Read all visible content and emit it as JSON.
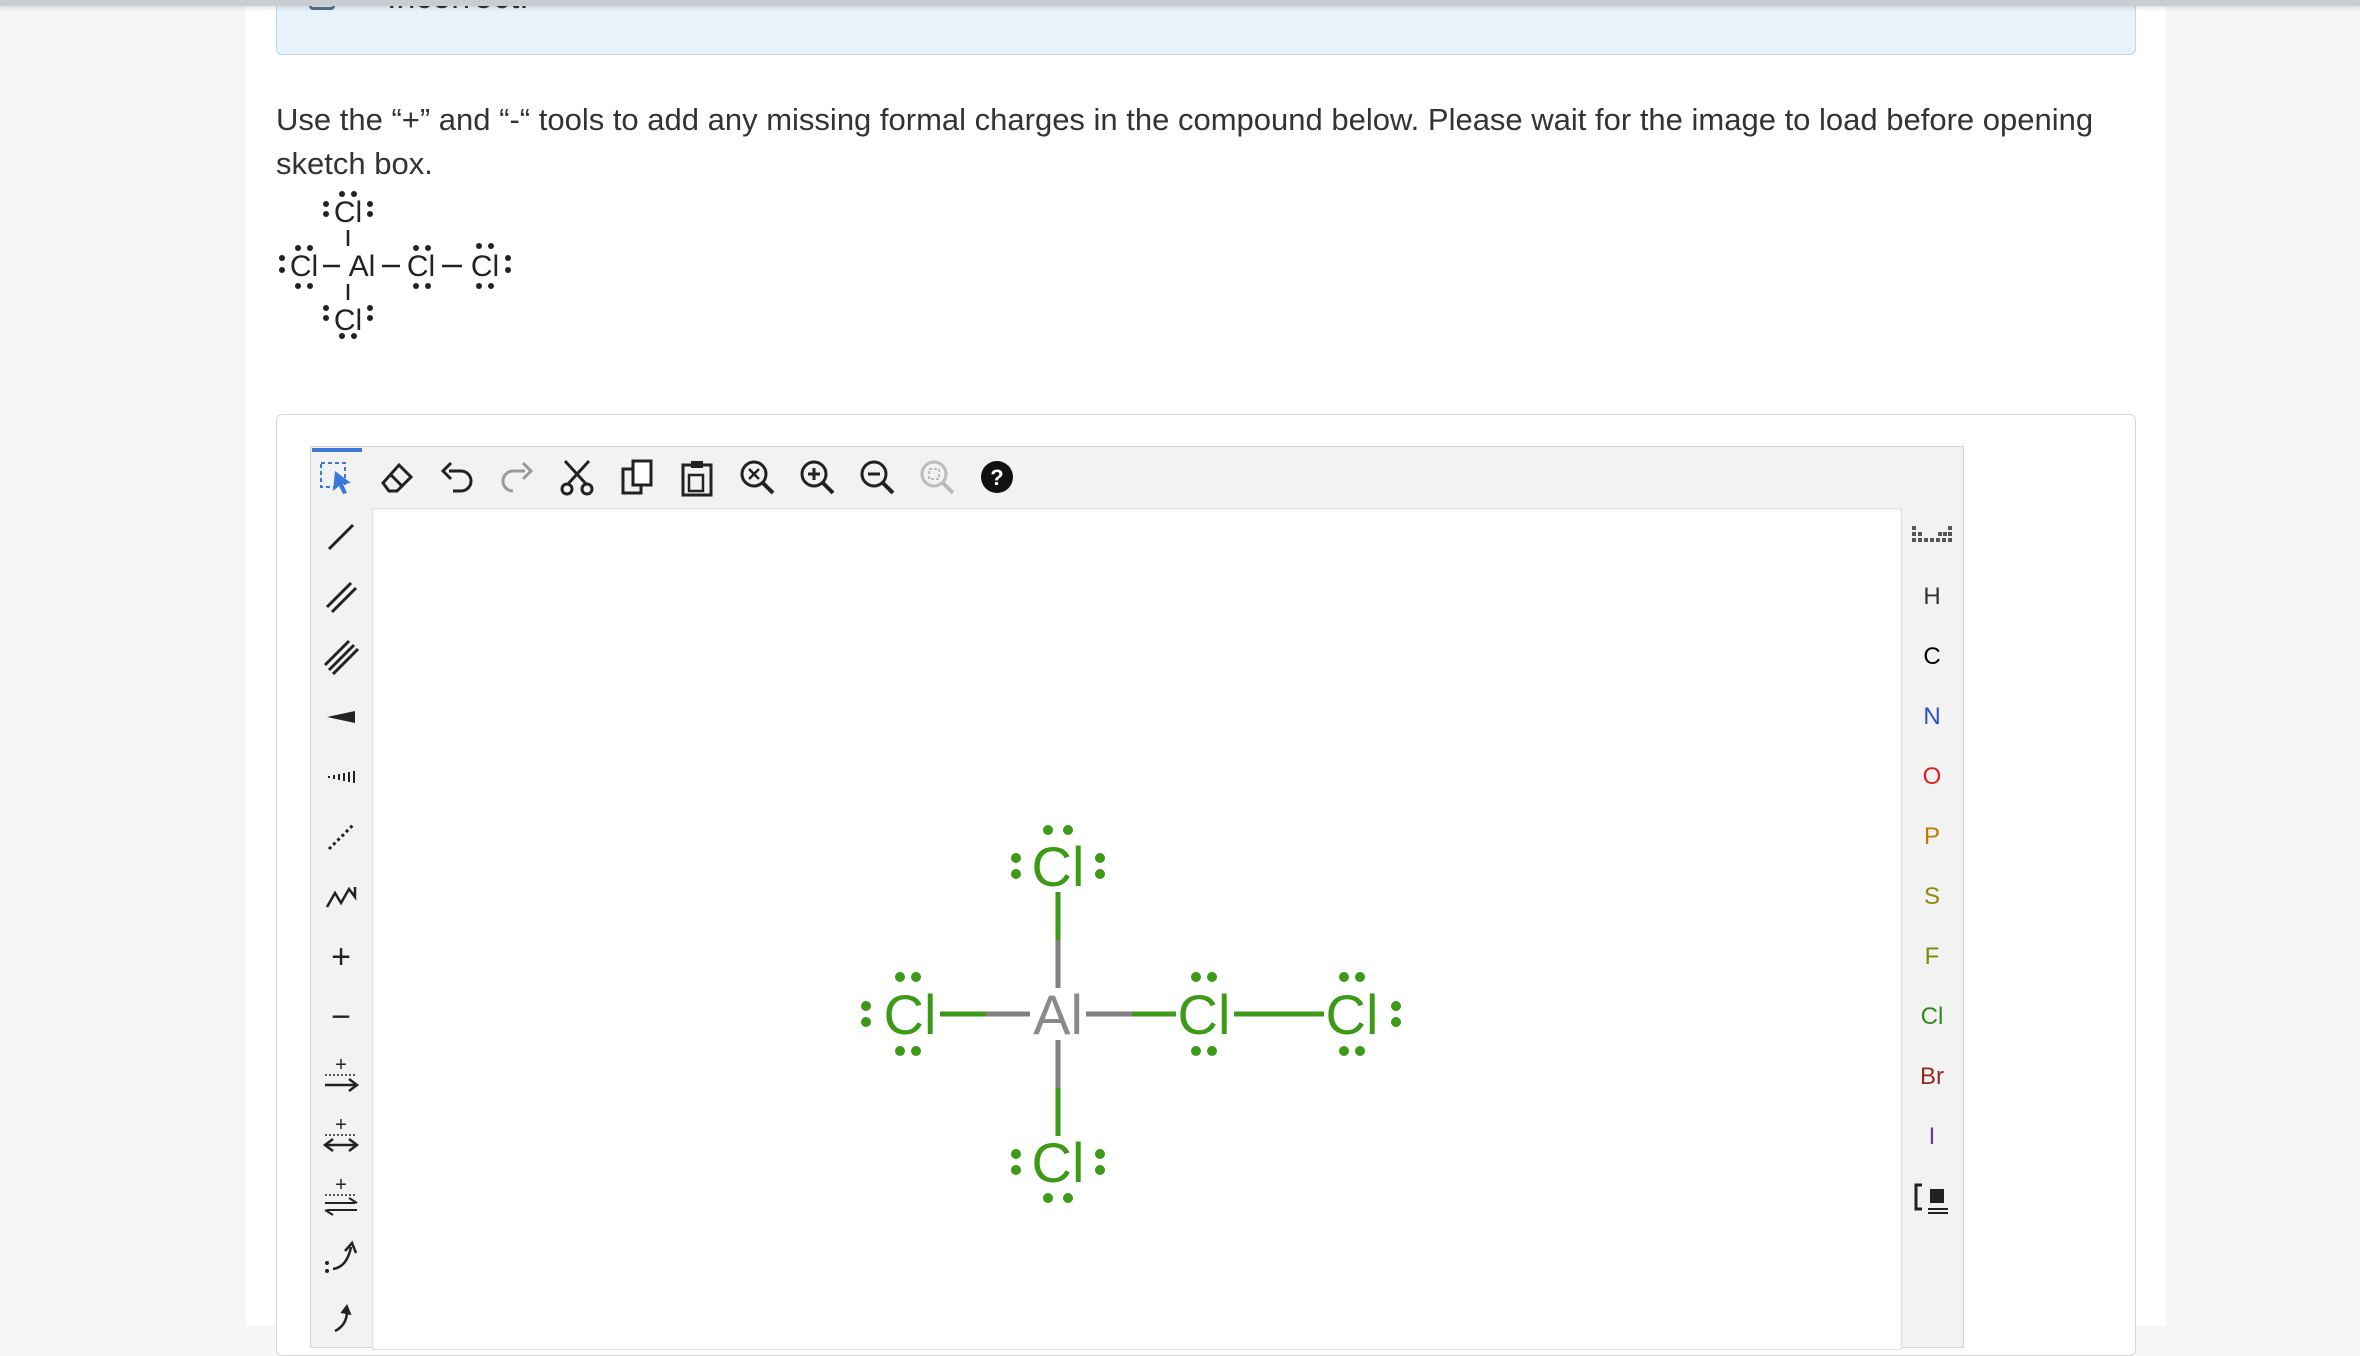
{
  "feedback": {
    "text": "Incorrect."
  },
  "question": {
    "prompt": "Use the “+” and “-“ tools to add any missing formal charges in the compound below. Please wait for the image to load before opening sketch box."
  },
  "structure": {
    "center": "Al",
    "top": "Cl",
    "bottom": "Cl",
    "left": "Cl",
    "bridge": "Cl",
    "far_right": "Cl"
  },
  "toolbar": {
    "items": [
      {
        "name": "select-tool",
        "icon": "select-arrow-icon"
      },
      {
        "name": "erase-tool",
        "icon": "eraser-icon"
      },
      {
        "name": "undo-tool",
        "icon": "undo-icon"
      },
      {
        "name": "redo-tool",
        "icon": "redo-icon"
      },
      {
        "name": "cut-tool",
        "icon": "scissors-icon"
      },
      {
        "name": "copy-tool",
        "icon": "copy-icon"
      },
      {
        "name": "paste-tool",
        "icon": "paste-icon"
      },
      {
        "name": "zoom-fit-tool",
        "icon": "zoom-fit-icon"
      },
      {
        "name": "zoom-in-tool",
        "icon": "zoom-in-icon"
      },
      {
        "name": "zoom-out-tool",
        "icon": "zoom-out-icon"
      },
      {
        "name": "zoom-reset-tool",
        "icon": "zoom-reset-icon"
      },
      {
        "name": "help-tool",
        "icon": "help-icon"
      }
    ]
  },
  "left_tools": {
    "items": [
      "single-bond",
      "double-bond",
      "triple-bond",
      "wedge-bond",
      "hash-bond",
      "dashed-bond",
      "chain",
      "charge-plus",
      "charge-minus",
      "reaction-arrow",
      "equilibrium-arrow",
      "resonance-arrow",
      "curved-arrow",
      "electron-arrow"
    ],
    "plus_label": "+",
    "minus_label": "−"
  },
  "elements": {
    "items": [
      {
        "symbol": "H",
        "color": "#333333"
      },
      {
        "symbol": "C",
        "color": "#000000"
      },
      {
        "symbol": "N",
        "color": "#2f4fd0"
      },
      {
        "symbol": "O",
        "color": "#e02020"
      },
      {
        "symbol": "P",
        "color": "#c07a00"
      },
      {
        "symbol": "S",
        "color": "#8a8a00"
      },
      {
        "symbol": "F",
        "color": "#7a8c00"
      },
      {
        "symbol": "Cl",
        "color": "#2e8b1e"
      },
      {
        "symbol": "Br",
        "color": "#8b2e1e"
      },
      {
        "symbol": "I",
        "color": "#7a2fa0"
      }
    ]
  },
  "colors": {
    "chlorine": "#3c9a17",
    "aluminium": "#8a8a8a",
    "bond_gray": "#808080",
    "accent": "#3b78d8"
  }
}
